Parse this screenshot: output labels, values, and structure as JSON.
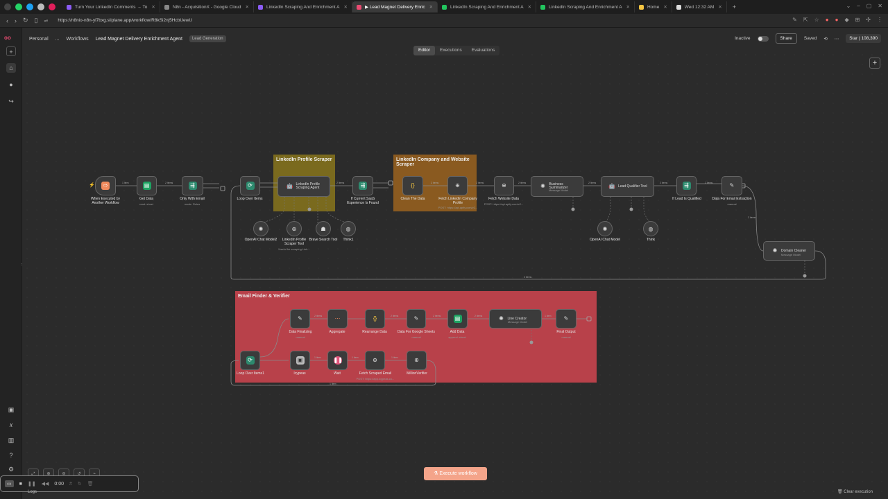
{
  "browser": {
    "tabs": [
      {
        "label": "Turn Your LinkedIn Comments → To",
        "fav": "#8b5cf6",
        "active": false
      },
      {
        "label": "N8n - AcquisitionX - Google Cloud",
        "fav": "#888888",
        "active": false
      },
      {
        "label": "LinkedIn Scraping And Enrichment A",
        "fav": "#8b5cf6",
        "active": false
      },
      {
        "label": "▶ Lead Magnet Delivery Enric",
        "fav": "#ea4b71",
        "active": true
      },
      {
        "label": "LinkedIn Scraping And Enrichment A",
        "fav": "#22c55e",
        "active": false
      },
      {
        "label": "LinkedIn Scraping And Enrichment A",
        "fav": "#22c55e",
        "active": false
      },
      {
        "label": "Home",
        "fav": "#f5c542",
        "active": false
      },
      {
        "label": "Wed 12:32 AM",
        "fav": "#dddddd",
        "active": false
      }
    ],
    "url": "https://n8nio-n8n-yl7bxg.sliplane.app/workflow/R8kSi2nj5HcbUewU"
  },
  "header": {
    "personal": "Personal",
    "ellipsis": "...",
    "workflows": "Workflows",
    "title": "Lead Magnet Delivery Enrichment Agent",
    "tag": "Lead Generation",
    "status": "Inactive",
    "share": "Share",
    "saved": "Saved",
    "star": "Star",
    "star_count": "108,390"
  },
  "modes": [
    "Editor",
    "Executions",
    "Evaluations"
  ],
  "stickies": {
    "profile": "LinkedIn Profile Scraper",
    "company": "LinkedIn Company and Website Scraper",
    "email": "Email Finder & Verifier"
  },
  "nodes": {
    "trigger": {
      "label": "When Executed by Another Workflow"
    },
    "get_data": {
      "label": "Get Data",
      "sub": "read: sheet"
    },
    "only_with_email": {
      "label": "Only With Email",
      "sub": "mode: Rules"
    },
    "loop1": {
      "label": "Loop Over Items"
    },
    "profile_agent": {
      "label": "LinkedIn Profile Scraping Agent"
    },
    "if_saas": {
      "label": "If Current SaaS Experience Is Found"
    },
    "clean_data": {
      "label": "Clean The Data"
    },
    "fetch_company": {
      "label": "Fetch LinkedIn Company Profile",
      "sub": "POST: https://api.apify.com/v2..."
    },
    "fetch_website": {
      "label": "Fetch Website Data",
      "sub": "POST: https://api.apify.com/v2..."
    },
    "business_summarizer": {
      "label": "Business Summarizer",
      "sub": "Message Model"
    },
    "lead_qualifier": {
      "label": "Lead Qualifier Tool"
    },
    "if_qualified": {
      "label": "If Lead Is Qualified"
    },
    "data_email_extraction": {
      "label": "Data For Email Extraction",
      "sub": "manual"
    },
    "domain_cleaner": {
      "label": "Domain Cleaner",
      "sub": "Message Model"
    },
    "openai2": {
      "label": "OpenAI Chat Model2"
    },
    "profile_scraper_tool": {
      "label": "LinkedIn Profile Scraper Tool",
      "sub": "Useful for scraping Link..."
    },
    "brave": {
      "label": "Brave Search Tool"
    },
    "think1": {
      "label": "Think1"
    },
    "openai_model": {
      "label": "OpenAI Chat Model"
    },
    "think": {
      "label": "Think"
    },
    "data_finalizing": {
      "label": "Data Finalizing",
      "sub": "manual"
    },
    "aggregate": {
      "label": "Aggregate"
    },
    "rearrange": {
      "label": "Rearrange Data"
    },
    "data_sheets": {
      "label": "Data For Google Sheets",
      "sub": "manual"
    },
    "add_data": {
      "label": "Add Data",
      "sub": "append: sheet"
    },
    "line_creator": {
      "label": "Line Creator",
      "sub": "Message Model"
    },
    "final_output": {
      "label": "Final Output",
      "sub": "manual"
    },
    "loop2": {
      "label": "Loop Over Items1"
    },
    "icypeas": {
      "label": "Icypeas"
    },
    "wait": {
      "label": "Wait"
    },
    "fetch_scraped_email": {
      "label": "Fetch Scraped Email",
      "sub": "POST: https://app.icypeas.co..."
    },
    "million_verifier": {
      "label": "MillionVerifier"
    }
  },
  "edge_labels": {
    "one_item": "1 item",
    "two_items": "2 items"
  },
  "execute": "Execute workflow",
  "bottom": {
    "time": "0:00",
    "logs": "Logs",
    "clear": "Clear execution"
  },
  "colors": {
    "accent": "#ea4b71",
    "execute": "#f4a48a",
    "sticky_yellow": "#7a6a1e",
    "sticky_orange": "#8a5a20",
    "sticky_red": "#b8414a"
  }
}
